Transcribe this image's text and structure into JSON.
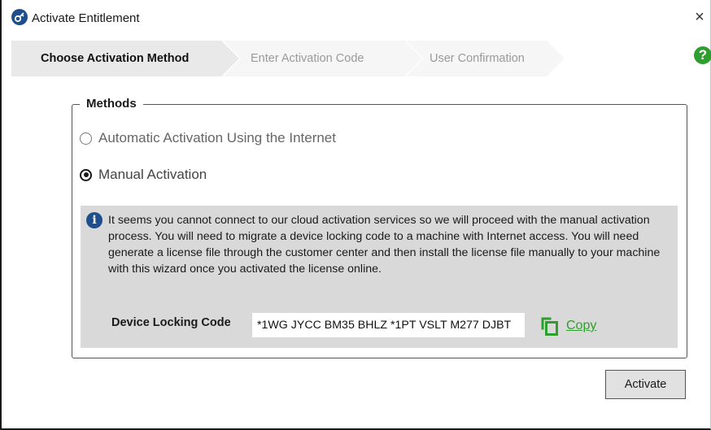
{
  "window": {
    "title": "Activate Entitlement",
    "close_glyph": "×",
    "app_icon": "key-icon"
  },
  "steps": [
    {
      "label": "Choose Activation Method",
      "state": "active"
    },
    {
      "label": "Enter Activation Code",
      "state": "inactive"
    },
    {
      "label": "User Confirmation",
      "state": "inactive"
    }
  ],
  "help": {
    "glyph": "?",
    "icon": "help-icon",
    "color": "#2e9e2e"
  },
  "methods": {
    "legend": "Methods",
    "options": [
      {
        "label": "Automatic Activation Using the Internet",
        "selected": false
      },
      {
        "label": "Manual Activation",
        "selected": true
      }
    ]
  },
  "info": {
    "icon_glyph": "i",
    "text": "It seems you cannot connect to our cloud activation services so we will proceed with the manual activation process. You will need to migrate a device locking code to a machine with Internet access. You will need generate a license file through the customer center and then install the license file manually to your machine with this wizard once you activated the license online.",
    "device_locking_code_label": "Device Locking Code",
    "device_locking_code_value": "*1WG JYCC BM35 BHLZ *1PT VSLT M277 DJBT",
    "copy_label": "Copy"
  },
  "buttons": {
    "activate": "Activate"
  },
  "colors": {
    "accent_green": "#2e9e2e",
    "brand_blue": "#1f4e8c"
  }
}
